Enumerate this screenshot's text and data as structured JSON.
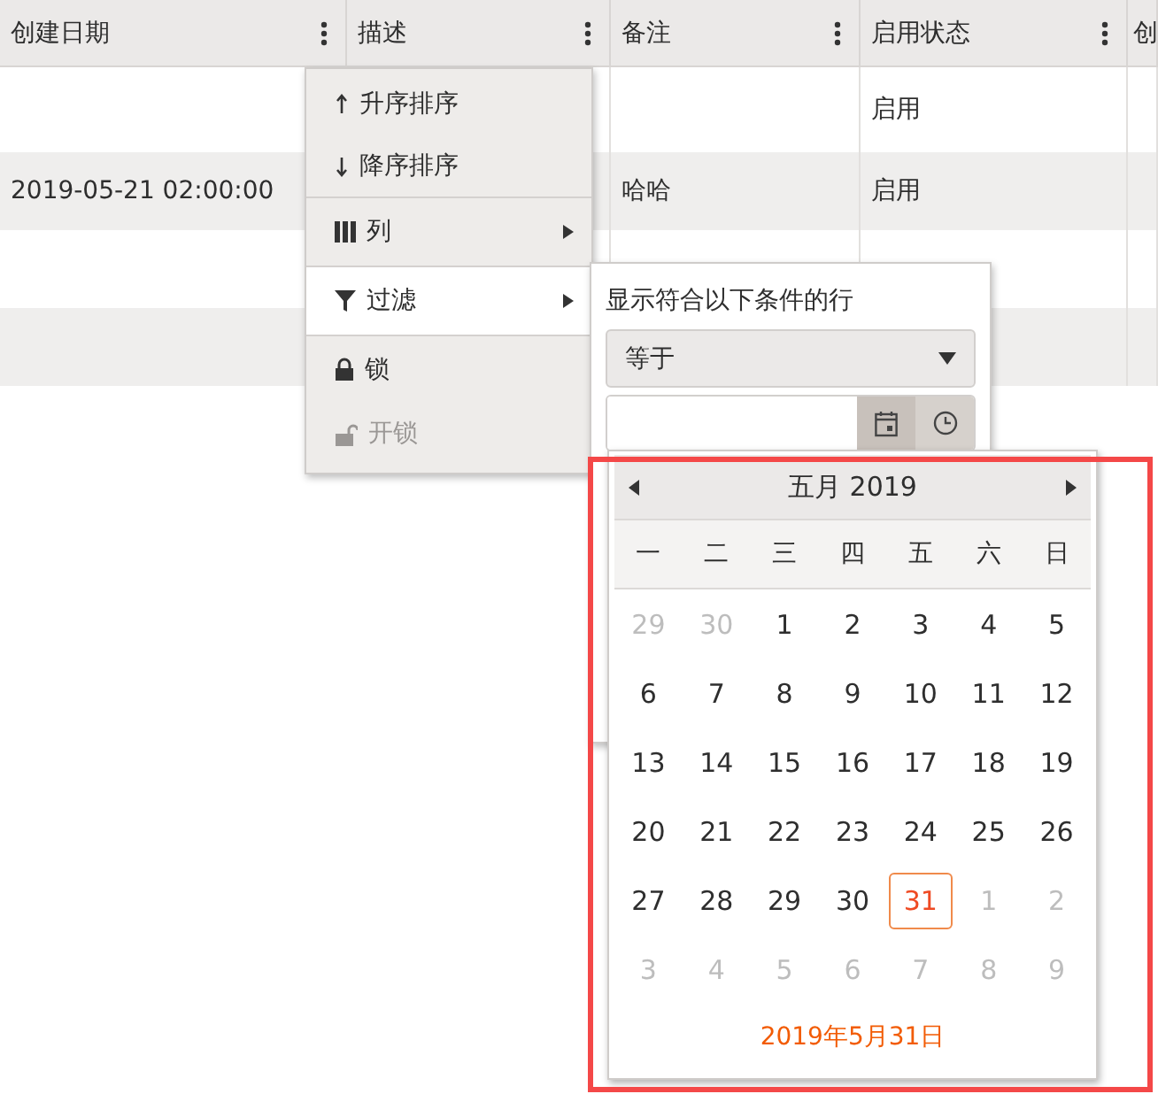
{
  "table": {
    "columns": [
      {
        "label": "创建日期"
      },
      {
        "label": "描述"
      },
      {
        "label": "备注"
      },
      {
        "label": "启用状态"
      },
      {
        "label": "创"
      }
    ],
    "rows": [
      {
        "cells": [
          "",
          "",
          "",
          "启用",
          ""
        ]
      },
      {
        "cells": [
          "2019-05-21 02:00:00",
          "",
          "哈哈",
          "启用",
          ""
        ]
      },
      {
        "cells": [
          "",
          "",
          "",
          "",
          ""
        ]
      },
      {
        "cells": [
          "",
          "",
          "",
          "",
          ""
        ]
      }
    ]
  },
  "column_menu": {
    "items": [
      {
        "kind": "sort-asc",
        "label": "升序排序",
        "selected": false,
        "disabled": false
      },
      {
        "kind": "sort-desc",
        "label": "降序排序",
        "selected": false,
        "disabled": false
      },
      {
        "kind": "columns",
        "label": "列",
        "selected": false,
        "disabled": false
      },
      {
        "kind": "filter",
        "label": "过滤",
        "selected": true,
        "disabled": false
      },
      {
        "kind": "lock",
        "label": "锁",
        "selected": false,
        "disabled": false
      },
      {
        "kind": "unlock",
        "label": "开锁",
        "selected": false,
        "disabled": true
      }
    ]
  },
  "filter": {
    "title": "显示符合以下条件的行",
    "operator": "等于"
  },
  "calendar": {
    "title": "五月 2019",
    "weekdays": [
      "一",
      "二",
      "三",
      "四",
      "五",
      "六",
      "日"
    ],
    "weeks": [
      [
        {
          "label": "29",
          "other_month": true,
          "selected": false
        },
        {
          "label": "30",
          "other_month": true,
          "selected": false
        },
        {
          "label": "1",
          "other_month": false,
          "selected": false
        },
        {
          "label": "2",
          "other_month": false,
          "selected": false
        },
        {
          "label": "3",
          "other_month": false,
          "selected": false
        },
        {
          "label": "4",
          "other_month": false,
          "selected": false
        },
        {
          "label": "5",
          "other_month": false,
          "selected": false
        }
      ],
      [
        {
          "label": "6",
          "other_month": false,
          "selected": false
        },
        {
          "label": "7",
          "other_month": false,
          "selected": false
        },
        {
          "label": "8",
          "other_month": false,
          "selected": false
        },
        {
          "label": "9",
          "other_month": false,
          "selected": false
        },
        {
          "label": "10",
          "other_month": false,
          "selected": false
        },
        {
          "label": "11",
          "other_month": false,
          "selected": false
        },
        {
          "label": "12",
          "other_month": false,
          "selected": false
        }
      ],
      [
        {
          "label": "13",
          "other_month": false,
          "selected": false
        },
        {
          "label": "14",
          "other_month": false,
          "selected": false
        },
        {
          "label": "15",
          "other_month": false,
          "selected": false
        },
        {
          "label": "16",
          "other_month": false,
          "selected": false
        },
        {
          "label": "17",
          "other_month": false,
          "selected": false
        },
        {
          "label": "18",
          "other_month": false,
          "selected": false
        },
        {
          "label": "19",
          "other_month": false,
          "selected": false
        }
      ],
      [
        {
          "label": "20",
          "other_month": false,
          "selected": false
        },
        {
          "label": "21",
          "other_month": false,
          "selected": false
        },
        {
          "label": "22",
          "other_month": false,
          "selected": false
        },
        {
          "label": "23",
          "other_month": false,
          "selected": false
        },
        {
          "label": "24",
          "other_month": false,
          "selected": false
        },
        {
          "label": "25",
          "other_month": false,
          "selected": false
        },
        {
          "label": "26",
          "other_month": false,
          "selected": false
        }
      ],
      [
        {
          "label": "27",
          "other_month": false,
          "selected": false
        },
        {
          "label": "28",
          "other_month": false,
          "selected": false
        },
        {
          "label": "29",
          "other_month": false,
          "selected": false
        },
        {
          "label": "30",
          "other_month": false,
          "selected": false
        },
        {
          "label": "31",
          "other_month": false,
          "selected": true
        },
        {
          "label": "1",
          "other_month": true,
          "selected": false
        },
        {
          "label": "2",
          "other_month": true,
          "selected": false
        }
      ],
      [
        {
          "label": "3",
          "other_month": true,
          "selected": false
        },
        {
          "label": "4",
          "other_month": true,
          "selected": false
        },
        {
          "label": "5",
          "other_month": true,
          "selected": false
        },
        {
          "label": "6",
          "other_month": true,
          "selected": false
        },
        {
          "label": "7",
          "other_month": true,
          "selected": false
        },
        {
          "label": "8",
          "other_month": true,
          "selected": false
        },
        {
          "label": "9",
          "other_month": true,
          "selected": false
        }
      ]
    ],
    "footer": "2019年5月31日"
  }
}
